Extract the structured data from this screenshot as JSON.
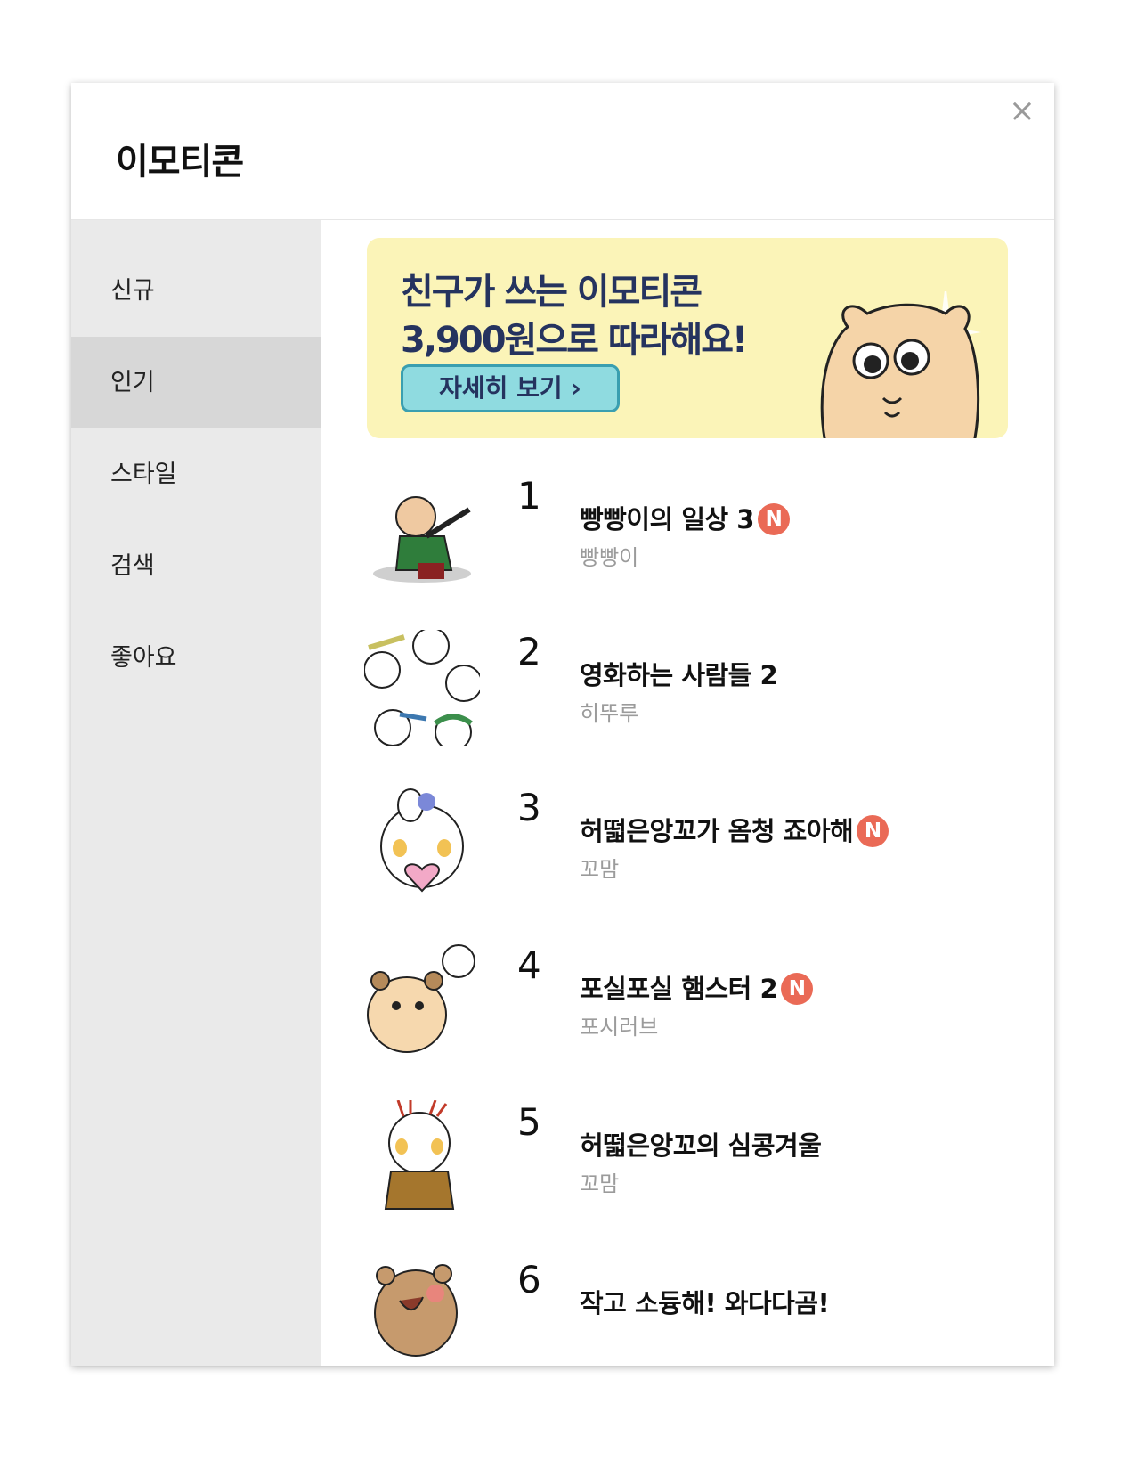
{
  "window": {
    "title": "이모티콘",
    "close_label": "×"
  },
  "sidebar": {
    "items": [
      {
        "label": "신규"
      },
      {
        "label": "인기"
      },
      {
        "label": "스타일"
      },
      {
        "label": "검색"
      },
      {
        "label": "좋아요"
      }
    ],
    "active_index": 1
  },
  "banner": {
    "line1": "친구가 쓰는 이모티콘",
    "line2": "3,900원으로 따라해요!",
    "button_label": "자세히 보기 ›",
    "background": "#fbf4b8",
    "button_color": "#8fdbe0"
  },
  "ranking": [
    {
      "rank": "1",
      "title": "빵빵이의 일상 3",
      "author": "빵빵이",
      "is_new": true,
      "badge": "N"
    },
    {
      "rank": "2",
      "title": "영화하는 사람들 2",
      "author": "히뚜루",
      "is_new": false,
      "badge": ""
    },
    {
      "rank": "3",
      "title": "허떫은앙꼬가 옴청 죠아해",
      "author": "꼬맘",
      "is_new": true,
      "badge": "N"
    },
    {
      "rank": "4",
      "title": "포실포실 햄스터 2",
      "author": "포시러브",
      "is_new": true,
      "badge": "N"
    },
    {
      "rank": "5",
      "title": "허떫은앙꼬의 심콩겨울",
      "author": "꼬맘",
      "is_new": false,
      "badge": ""
    },
    {
      "rank": "6",
      "title": "작고 소듕해! 와다다곰!",
      "author": "",
      "is_new": false,
      "badge": ""
    }
  ],
  "colors": {
    "badge_new": "#ea6a56",
    "sidebar_bg": "#eaeaea",
    "sidebar_active": "#d7d7d7",
    "author_text": "#9b9b9b"
  }
}
